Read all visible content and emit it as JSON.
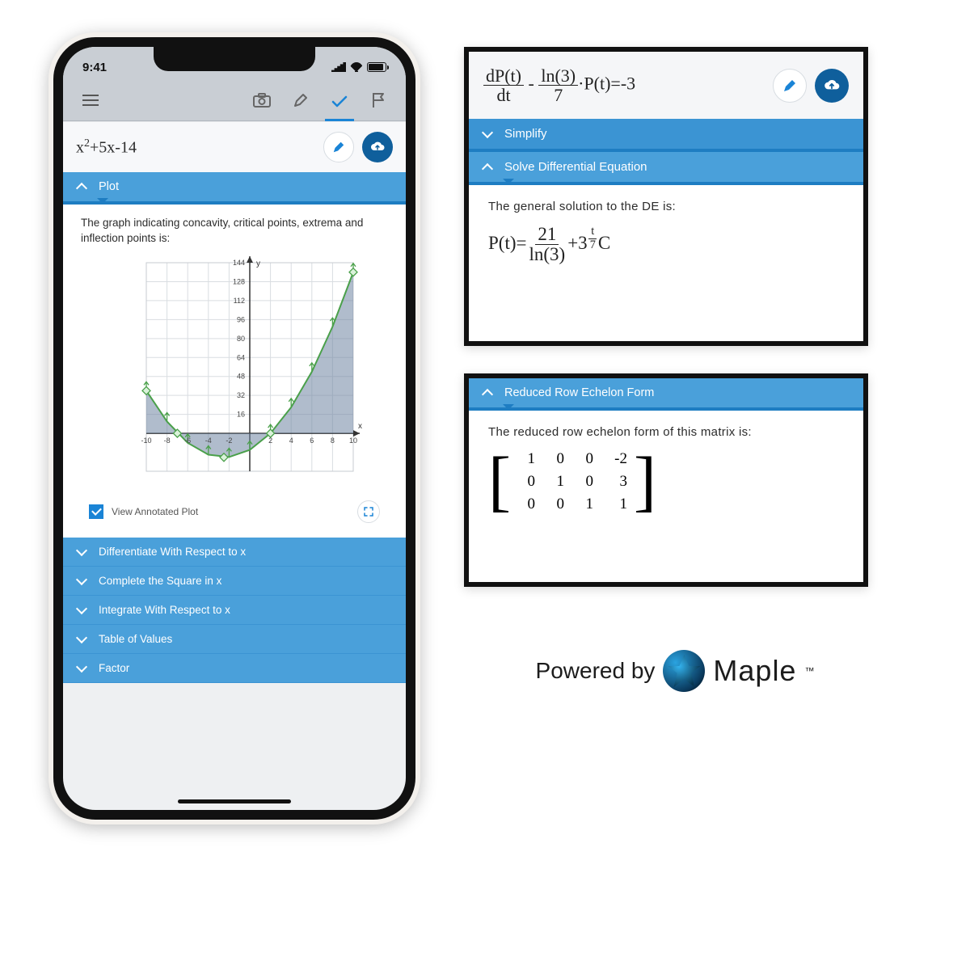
{
  "phone": {
    "status": {
      "time": "9:41"
    },
    "expression": "x²+5x-14",
    "plot_section": {
      "title": "Plot",
      "description": "The graph indicating concavity, critical points, extrema and inflection points is:",
      "annotated_checkbox_label": "View Annotated Plot"
    },
    "accordion_items": [
      "Differentiate With Respect to x",
      "Complete the Square in x",
      "Integrate With Respect to x",
      "Table of Values",
      "Factor"
    ]
  },
  "card1": {
    "equation_html": "<span class='frac'><span class='num'>dP(t)</span><span class='den'>dt</span></span> - <span class='frac'><span class='num'>ln(3)</span><span class='den'>7</span></span>·P(t)=-3",
    "simplify": "Simplify",
    "solve_de": "Solve Differential Equation",
    "body_text": "The general solution to the DE is:",
    "solution_html": "P(t)=<span class='frac'><span class='num'>21</span><span class='den'>ln(3)</span></span>+3<sup><span class='frac' style='font-size:0.75em'><span class='num'>t</span><span class='den'>7</span></span></sup>C"
  },
  "card2": {
    "title": "Reduced Row Echelon Form",
    "body_text": "The reduced row echelon form of this matrix is:",
    "matrix": [
      [
        "1",
        "0",
        "0",
        "-2"
      ],
      [
        "0",
        "1",
        "0",
        "3"
      ],
      [
        "0",
        "0",
        "1",
        "1"
      ]
    ]
  },
  "badge": {
    "powered_by": "Powered by",
    "brand": "Maple"
  },
  "chart_data": {
    "type": "line",
    "title": "",
    "xlabel": "x",
    "ylabel": "y",
    "xlim": [
      -10,
      10
    ],
    "ylim": [
      -32,
      144
    ],
    "xticks": [
      -10,
      -8,
      -6,
      -4,
      -2,
      2,
      4,
      6,
      8,
      10
    ],
    "yticks": [
      16,
      32,
      48,
      64,
      80,
      96,
      112,
      128,
      144
    ],
    "series": [
      {
        "name": "x^2+5x-14",
        "x": [
          -10,
          -8,
          -6,
          -4,
          -2,
          0,
          2,
          4,
          6,
          8,
          10
        ],
        "values": [
          36,
          10,
          -8,
          -18,
          -20,
          -14,
          0,
          22,
          52,
          90,
          136
        ]
      }
    ],
    "critical_points": {
      "roots": [
        -7,
        2
      ],
      "vertex": {
        "x": -2.5,
        "y": -20.25
      }
    }
  },
  "colors": {
    "accent": "#4aa0da",
    "accent_dark": "#1e7dc2",
    "icon_blue": "#1a84d6"
  }
}
